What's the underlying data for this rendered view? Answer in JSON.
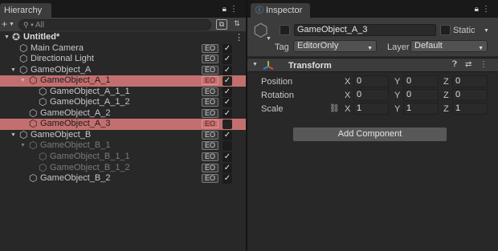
{
  "hierarchy": {
    "tab_title": "Hierarchy",
    "search_placeholder": "All",
    "scene_name": "Untitled*",
    "badge_label": "EO",
    "check_glyph": "✓",
    "items": [
      {
        "label": "Main Camera",
        "badge": true,
        "checked": true,
        "selected": false,
        "inactive": false
      },
      {
        "label": "Directional Light",
        "badge": true,
        "checked": true,
        "selected": false,
        "inactive": false
      },
      {
        "label": "GameObject_A",
        "badge": true,
        "checked": true,
        "selected": false,
        "inactive": false
      },
      {
        "label": "GameObject_A_1",
        "badge": true,
        "checked": true,
        "selected": true,
        "inactive": false
      },
      {
        "label": "GameObject_A_1_1",
        "badge": true,
        "checked": true,
        "selected": false,
        "inactive": false
      },
      {
        "label": "GameObject_A_1_2",
        "badge": true,
        "checked": true,
        "selected": false,
        "inactive": false
      },
      {
        "label": "GameObject_A_2",
        "badge": true,
        "checked": true,
        "selected": false,
        "inactive": false
      },
      {
        "label": "GameObject_A_3",
        "badge": true,
        "checked": false,
        "selected": true,
        "inactive": true
      },
      {
        "label": "GameObject_B",
        "badge": true,
        "checked": true,
        "selected": false,
        "inactive": false
      },
      {
        "label": "GameObject_B_1",
        "badge": true,
        "checked": false,
        "selected": false,
        "inactive": true
      },
      {
        "label": "GameObject_B_1_1",
        "badge": true,
        "checked": true,
        "selected": false,
        "inactive": true
      },
      {
        "label": "GameObject_B_1_2",
        "badge": true,
        "checked": true,
        "selected": false,
        "inactive": true
      },
      {
        "label": "GameObject_B_2",
        "badge": true,
        "checked": true,
        "selected": false,
        "inactive": false
      }
    ]
  },
  "inspector": {
    "tab_title": "Inspector",
    "object_name": "GameObject_A_3",
    "static_label": "Static",
    "tag_label": "Tag",
    "tag_value": "EditorOnly",
    "layer_label": "Layer",
    "layer_value": "Default",
    "component_title": "Transform",
    "transform": {
      "position": {
        "label": "Position",
        "x": "0",
        "y": "0",
        "z": "0"
      },
      "rotation": {
        "label": "Rotation",
        "x": "0",
        "y": "0",
        "z": "0"
      },
      "scale": {
        "label": "Scale",
        "x": "1",
        "y": "1",
        "z": "1"
      }
    },
    "axis_labels": {
      "x": "X",
      "y": "Y",
      "z": "Z"
    },
    "add_component_label": "Add Component"
  },
  "colors": {
    "selection": "#c46f6f",
    "panel": "#282828",
    "header": "#3c3c3c",
    "axis_x": "#e24b3b",
    "axis_y": "#8ac53e",
    "axis_z": "#3d7ee0"
  },
  "icons": {
    "scene": "unity-logo-icon",
    "gameobject": "cube-icon",
    "lock": "lock-icon",
    "menu": "kebab-menu-icon",
    "search": "search-icon",
    "help": "help-icon",
    "presets": "presets-icon",
    "link": "constrain-proportions-icon"
  }
}
